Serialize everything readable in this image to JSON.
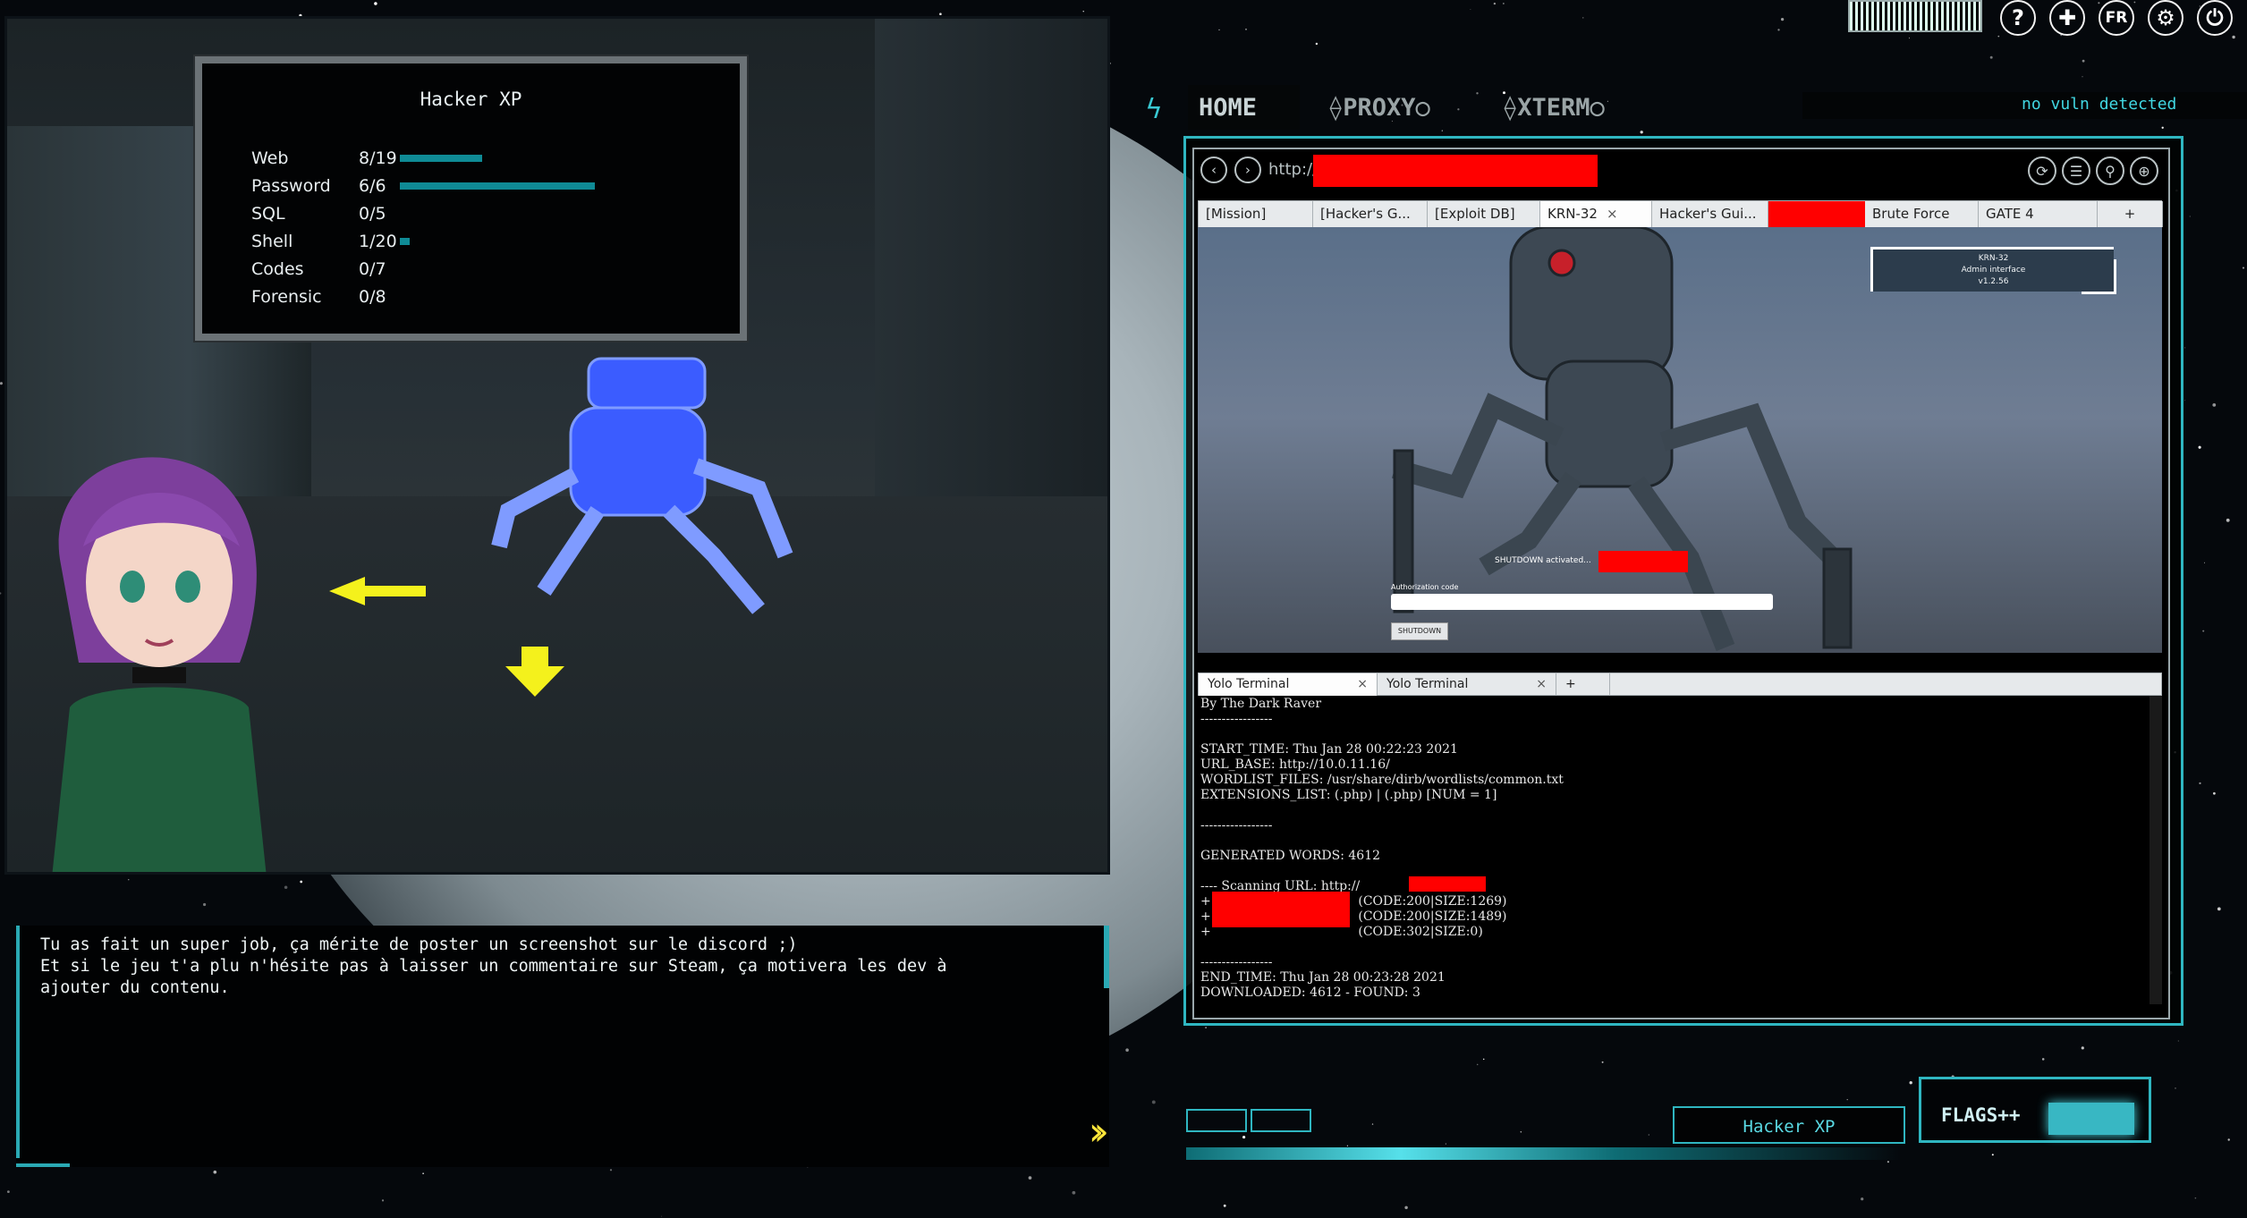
{
  "xp_panel": {
    "title": "Hacker XP",
    "skills": [
      {
        "name": "Web",
        "value": "8/19",
        "progress": 0.42
      },
      {
        "name": "Password",
        "value": "6/6",
        "progress": 1.0
      },
      {
        "name": "SQL",
        "value": "0/5",
        "progress": 0
      },
      {
        "name": "Shell",
        "value": "1/20",
        "progress": 0.05
      },
      {
        "name": "Codes",
        "value": "0/7",
        "progress": 0
      },
      {
        "name": "Forensic",
        "value": "0/8",
        "progress": 0
      }
    ]
  },
  "dialog": {
    "text": "Tu as fait un super job, ça mérite de poster un screenshot sur le discord ;)\nEt si le jeu t'a plu n'hésite pas à laisser un commentaire sur Steam, ça motivera les dev à\najouter du contenu.",
    "next_label": "››"
  },
  "top_icons": [
    {
      "icon": "help-icon",
      "glyph": "?"
    },
    {
      "icon": "bandage-icon",
      "glyph": "✚"
    },
    {
      "icon": "language-icon",
      "glyph": "FR"
    },
    {
      "icon": "settings-icon",
      "glyph": "⚙"
    },
    {
      "icon": "power-icon",
      "glyph": "⏻"
    }
  ],
  "hud": {
    "bolt": "ϟ",
    "tabs": {
      "home": "HOME",
      "proxy": "⟠PROXY○",
      "xterm": "⟠XTERM○"
    },
    "vuln_status": "no vuln detected"
  },
  "browser": {
    "back": "‹",
    "forward": "›",
    "url_prefix": "http://",
    "tools": [
      {
        "icon": "refresh-icon",
        "glyph": "⟳"
      },
      {
        "icon": "bookmarks-icon",
        "glyph": "☰"
      },
      {
        "icon": "search-icon",
        "glyph": "⚲"
      },
      {
        "icon": "zoom-icon",
        "glyph": "⊕"
      }
    ],
    "tabs": [
      {
        "label": "[Mission]"
      },
      {
        "label": "[Hacker's G..."
      },
      {
        "label": "[Exploit DB]"
      },
      {
        "label": "KRN-32",
        "close": "×",
        "active": true
      },
      {
        "label": "Hacker's Gui..."
      },
      {
        "label": "",
        "redacted": true
      },
      {
        "label": "Brute Force"
      },
      {
        "label": "GATE 4"
      },
      {
        "label": "+"
      }
    ],
    "page": {
      "admin_title": "KRN-32",
      "admin_subtitle": "Admin interface",
      "admin_version": "v1.2.56",
      "shutdown_status": "SHUTDOWN activated...",
      "auth_label": "Authorization code",
      "shutdown_button": "SHUTDOWN"
    }
  },
  "terminal": {
    "tabs": [
      {
        "label": "Yolo Terminal",
        "close": "×",
        "active": true
      },
      {
        "label": "Yolo Terminal",
        "close": "×"
      },
      {
        "label": "+"
      }
    ],
    "lines": [
      "By The Dark Raver",
      "-----------------",
      "",
      "START_TIME: Thu Jan 28 00:22:23 2021",
      "URL_BASE: http://10.0.11.16/",
      "WORDLIST_FILES: /usr/share/dirb/wordlists/common.txt",
      "EXTENSIONS_LIST: (.php) | (.php) [NUM = 1]",
      "",
      "-----------------",
      "",
      "GENERATED WORDS: 4612",
      "",
      "---- Scanning URL: http://             / ----",
      "+                                     (CODE:200|SIZE:1269)",
      "+                                     (CODE:200|SIZE:1489)",
      "+                                     (CODE:302|SIZE:0)",
      "",
      "-----------------",
      "END_TIME: Thu Jan 28 00:23:28 2021",
      "DOWNLOADED: 4612 - FOUND: 3"
    ]
  },
  "bottom": {
    "xp_button": "Hacker XP",
    "flags_button": "FLAGS++"
  },
  "colors": {
    "accent": "#2fb6c1",
    "xp_bar": "#0f8b96",
    "redaction": "#ff0000",
    "hologram": "#3a5bff",
    "arrow": "#f4f11c"
  }
}
